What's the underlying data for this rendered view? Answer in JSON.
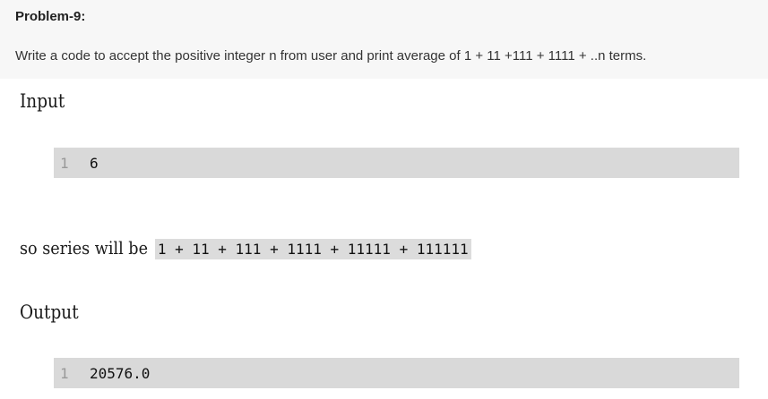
{
  "problem": {
    "title": "Problem-9:",
    "description": "Write a code to accept the positive integer n from user and print average of 1 + 11 +111 + 1111 + ..n terms."
  },
  "input": {
    "heading": "Input",
    "line_number": "1",
    "code": "6"
  },
  "series": {
    "prefix": "so series will be",
    "expression": "1 + 11 + 111 + 1111 + 11111 + 111111"
  },
  "output": {
    "heading": "Output",
    "line_number": "1",
    "code": "20576.0"
  }
}
